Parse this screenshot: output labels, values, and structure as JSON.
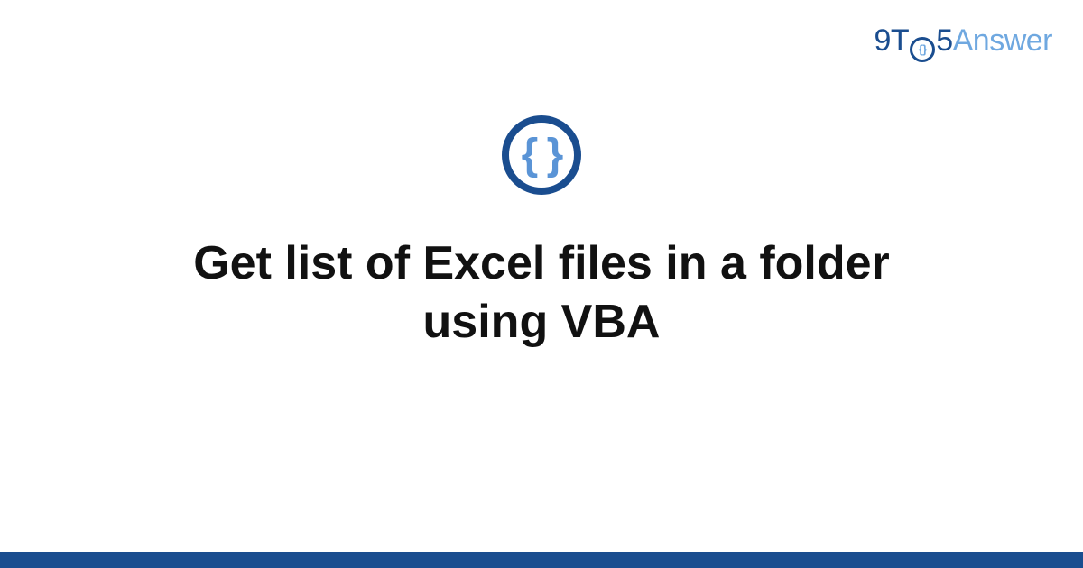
{
  "brand": {
    "part1": "9T",
    "ring_inner": "{}",
    "part2": "5",
    "part3": "Answer"
  },
  "icon": {
    "braces": "{ }"
  },
  "title": "Get list of Excel files in a folder using VBA"
}
